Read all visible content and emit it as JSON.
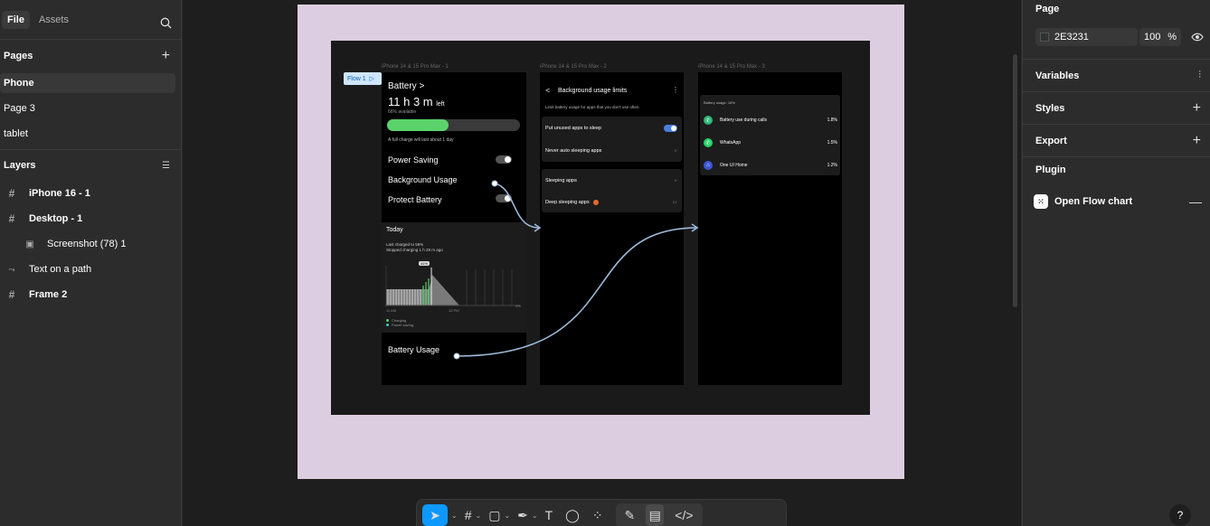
{
  "left": {
    "tabs": [
      "File",
      "Assets"
    ],
    "pages_title": "Pages",
    "pages": [
      "Phone",
      "Page 3",
      "tablet"
    ],
    "layers_title": "Layers",
    "layers": [
      "iPhone 16 - 1",
      "Desktop - 1",
      "Screenshot (78) 1",
      "Text on a path",
      "Frame 2"
    ]
  },
  "canvas": {
    "flow_label": "Flow 1",
    "phone_labels": [
      "iPhone 14 & 15 Pro Max - 1",
      "iPhone 14 & 15 Pro Max - 2",
      "iPhone 14 & 15 Pro Max - 3"
    ],
    "p1": {
      "title": "Battery >",
      "time_big": "11 h 3 m",
      "time_suffix": "left",
      "available": "66% available",
      "note": "A full charge will last about 1 day",
      "rows": [
        "Power Saving",
        "Background Usage",
        "Protect Battery"
      ],
      "today": "Today",
      "charged": "Last charged to 55%",
      "stopped": "Stopped charging 1 h 29 m ago",
      "chart_tag": "41%",
      "chart_start": "11 AM",
      "chart_mid": "12 PM",
      "chart_pct": "0%",
      "legend": [
        "Charging",
        "Power saving"
      ],
      "battery_usage": "Battery Usage"
    },
    "p2": {
      "title": "Background usage limits",
      "desc": "Limit battery usage for apps that you don't use often.",
      "rows": [
        "Put unused apps to sleep",
        "Never auto sleeping apps",
        "Sleeping apps",
        "Deep sleeping apps"
      ],
      "counts": [
        "0",
        "0",
        "21"
      ]
    },
    "p3": {
      "header": "Battery usage: 16%",
      "apps": [
        {
          "name": "Battery use during calls",
          "pct": "1.8%"
        },
        {
          "name": "WhatsApp",
          "pct": "1.5%"
        },
        {
          "name": "One UI Home",
          "pct": "1.2%"
        }
      ]
    }
  },
  "right": {
    "page_title": "Page",
    "color_hex": "2E3231",
    "opacity": "100",
    "opacity_unit": "%",
    "sections": [
      "Variables",
      "Styles",
      "Export"
    ],
    "plugin_title": "Plugin",
    "plugin_item": "Open Flow chart",
    "help": "?"
  },
  "colors": {
    "accent": "#0d99ff",
    "frame_bg": "#ddcde0",
    "canvas_bg": "#1e1e1e"
  }
}
